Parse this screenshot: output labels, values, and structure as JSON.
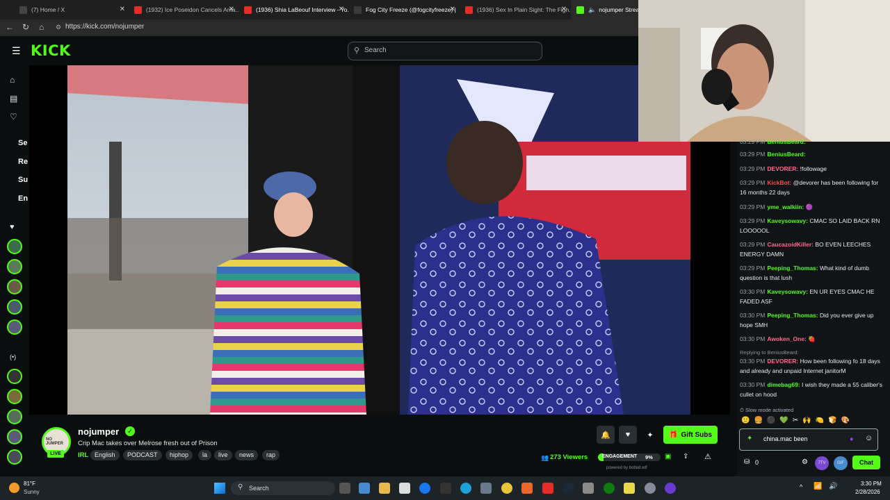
{
  "browser": {
    "tabs": [
      {
        "label": "(7) Home / X",
        "color": "#333333"
      },
      {
        "label": "(1932) Ice Poseidon Cancels Ama...",
        "color": "#e52d27"
      },
      {
        "label": "(1936) Shia LaBeouf Interview - Yo...",
        "color": "#e52d27"
      },
      {
        "label": "Fog City Freeze (@fogcityfreeze) |",
        "color": "#222222"
      },
      {
        "label": "(1936) Sex In Plain Sight: The Figh...",
        "color": "#e52d27"
      },
      {
        "label": "nojumper Stream",
        "color": "#53fc18"
      }
    ],
    "url": "https://kick.com/nojumper"
  },
  "header": {
    "logo": "KICK",
    "search_placeholder": "Search"
  },
  "sidebar": {
    "labels": [
      "Se",
      "Re",
      "Su",
      "En"
    ]
  },
  "stream": {
    "channel": "nojumper",
    "avatar_text": "NO JUMPER",
    "live": "LIVE",
    "title": "Crip Mac takes over Melrose fresh out of Prison",
    "category": "IRL",
    "tags": [
      "English",
      "PODCAST",
      "hiphop",
      "la",
      "live",
      "news",
      "rap"
    ],
    "viewers": "273 Viewers",
    "engagement_label": "ENGAGEMENT",
    "engagement_value": "9%",
    "powered_by": "powered by botted.wtf",
    "gift_subs": "Gift Subs"
  },
  "chat": {
    "messages": [
      {
        "time": "03:29 PM",
        "user": "BeniusBeard:",
        "color": "#53fc18",
        "text": ""
      },
      {
        "time": "03:29 PM",
        "user": "BeniusBeard:",
        "color": "#53fc18",
        "text": ""
      },
      {
        "time": "03:29 PM",
        "user": "DEVORER:",
        "color": "#ff6b8a",
        "text": "!followage"
      },
      {
        "time": "03:29 PM",
        "user": "KickBot:",
        "color": "#ff4a4a",
        "text": "@devorer has been following for 16 months 22 days"
      },
      {
        "time": "03:29 PM",
        "user": "yme_walkiin:",
        "color": "#53fc18",
        "text": "🟣"
      },
      {
        "time": "03:29 PM",
        "user": "Kaveysowavy:",
        "color": "#53fc18",
        "text": "CMAC SO LAID BACK RN LOOOOOL"
      },
      {
        "time": "03:29 PM",
        "user": "CaucazoidKiller:",
        "color": "#ff6b8a",
        "text": "BO EVEN LEECHES ENERGY DAMN"
      },
      {
        "time": "03:29 PM",
        "user": "Peeping_Thomas:",
        "color": "#53fc18",
        "text": "What kind of dumb question is that lush"
      },
      {
        "time": "03:30 PM",
        "user": "Kaveysowavy:",
        "color": "#53fc18",
        "text": "EN UR EYES CMAC HE FADED ASF"
      },
      {
        "time": "03:30 PM",
        "user": "Peeping_Thomas:",
        "color": "#53fc18",
        "text": "Did you ever give up hope SMH"
      },
      {
        "time": "03:30 PM",
        "user": "Awoken_One:",
        "color": "#ff6b8a",
        "text": "🍓"
      }
    ],
    "reply_to": "Replying to BeniusBeard:",
    "messages2": [
      {
        "time": "03:30 PM",
        "user": "DEVORER:",
        "color": "#ff6b8a",
        "text": "How been following fo 18 days and already and unpaid Internet janitorM"
      },
      {
        "time": "03:30 PM",
        "user": "dimebag69:",
        "color": "#53fc18",
        "text": "I wish they made a 55 caliber's cullet on hood"
      }
    ],
    "slow_mode": "Slow mode activated",
    "input_value": "china.mac been",
    "points": "0",
    "chat_button": "Chat"
  },
  "taskbar": {
    "weather_temp": "81°F",
    "weather_desc": "Sunny",
    "search": "Search",
    "time": "3:30 PM",
    "date": "2/28/2026"
  }
}
